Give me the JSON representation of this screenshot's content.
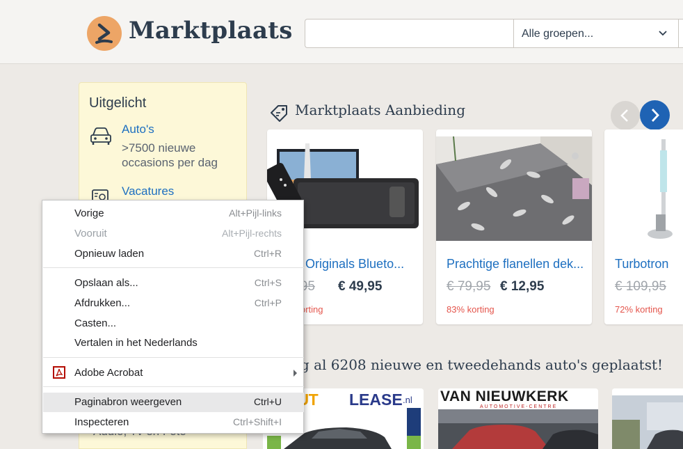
{
  "header": {
    "logo_text": "Marktplaats",
    "search_value": "",
    "group_select": "Alle groepen..."
  },
  "colors": {
    "logo": "#eda566",
    "link": "#1d6fc0",
    "discount": "#e4554c",
    "nav_next": "#1f63b4",
    "sidebar": "#fdf8d8"
  },
  "sidebar": {
    "title": "Uitgelicht",
    "items": [
      {
        "label": "Auto's",
        "description": ">7500 nieuwe occasions per dag",
        "icon": "car-icon"
      },
      {
        "label": "Vacatures",
        "description": "",
        "icon": "job-icon"
      }
    ],
    "bottom_text": "Audio, Tv en Foto"
  },
  "offers": {
    "title": "Marktplaats Aanbieding",
    "icon": "price-tag-icon",
    "cards": [
      {
        "title": "h Originals Blueto...",
        "old_price": "9,95",
        "new_price": "€ 49,95",
        "discount": "orting"
      },
      {
        "title": "Prachtige flanellen dek...",
        "old_price": "€ 79,95",
        "new_price": "€ 12,95",
        "discount": "83% korting"
      },
      {
        "title": "Turbotron",
        "old_price": "€ 109,95",
        "new_price": "",
        "discount": "72% korting"
      }
    ]
  },
  "cars": {
    "title": "ag al 6208 nieuwe en tweedehands auto's geplaatst!",
    "ads": [
      {
        "brand": "OAUT",
        "brand2": "LEASE",
        "suffix": ".nl"
      },
      {
        "brand": "VAN NIEUWKERK",
        "subtitle": "AUTOMOTIVE-CENTRE"
      },
      {
        "brand": ""
      }
    ]
  },
  "context_menu": {
    "items": [
      {
        "label": "Vorige",
        "shortcut": "Alt+Pijl-links",
        "disabled": false
      },
      {
        "label": "Vooruit",
        "shortcut": "Alt+Pijl-rechts",
        "disabled": true
      },
      {
        "label": "Opnieuw laden",
        "shortcut": "Ctrl+R",
        "disabled": false
      },
      {
        "label": "Opslaan als...",
        "shortcut": "Ctrl+S",
        "disabled": false
      },
      {
        "label": "Afdrukken...",
        "shortcut": "Ctrl+P",
        "disabled": false
      },
      {
        "label": "Casten...",
        "shortcut": "",
        "disabled": false
      },
      {
        "label": "Vertalen in het Nederlands",
        "shortcut": "",
        "disabled": false
      },
      {
        "label": "Adobe Acrobat",
        "shortcut": "",
        "submenu": true
      },
      {
        "label": "Paginabron weergeven",
        "shortcut": "Ctrl+U",
        "highlighted": true
      },
      {
        "label": "Inspecteren",
        "shortcut": "Ctrl+Shift+I",
        "disabled": false
      }
    ]
  }
}
